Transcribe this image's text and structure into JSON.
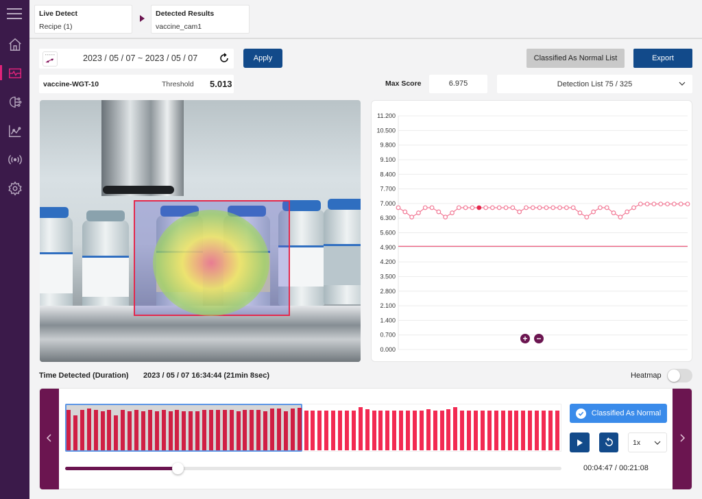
{
  "sidebar": {
    "items": [
      {
        "name": "home",
        "active": false
      },
      {
        "name": "monitor",
        "active": true
      },
      {
        "name": "ai-model",
        "active": false
      },
      {
        "name": "analytics",
        "active": false
      },
      {
        "name": "broadcast",
        "active": false
      },
      {
        "name": "settings",
        "active": false
      }
    ]
  },
  "breadcrumb": [
    {
      "title": "Live Detect",
      "subtitle": "Recipe (1)"
    },
    {
      "title": "Detected Results",
      "subtitle": "vaccine_cam1"
    }
  ],
  "filters": {
    "date_range": "2023 / 05 / 07 ~ 2023 / 05 / 07",
    "apply_label": "Apply",
    "classified_list_label": "Classified As Normal List",
    "export_label": "Export"
  },
  "info": {
    "model_name": "vaccine-WGT-10",
    "threshold_label": "Threshold",
    "threshold_value": "5.013",
    "max_score_label": "Max Score",
    "max_score_value": "6.975",
    "detection_list": "Detection List 75 / 325"
  },
  "chart_data": {
    "type": "line",
    "title": "",
    "xlabel": "",
    "ylabel": "",
    "ylim": [
      0,
      11.2
    ],
    "y_ticks": [
      "11.200",
      "10.500",
      "9.800",
      "9.100",
      "8.400",
      "7.700",
      "7.000",
      "6.300",
      "5.600",
      "4.900",
      "4.200",
      "3.500",
      "2.800",
      "2.100",
      "1.400",
      "0.700",
      "0.000"
    ],
    "grid": true,
    "threshold": 4.95,
    "highlight_index": 12,
    "values": [
      6.8,
      6.6,
      6.35,
      6.55,
      6.8,
      6.8,
      6.6,
      6.35,
      6.55,
      6.8,
      6.8,
      6.8,
      6.8,
      6.8,
      6.8,
      6.8,
      6.8,
      6.8,
      6.6,
      6.8,
      6.8,
      6.8,
      6.8,
      6.8,
      6.8,
      6.8,
      6.8,
      6.55,
      6.35,
      6.6,
      6.8,
      6.8,
      6.55,
      6.35,
      6.6,
      6.8,
      6.975,
      6.975,
      6.975,
      6.975,
      6.975,
      6.975,
      6.975,
      6.975
    ],
    "zoom_in_label": "+",
    "zoom_out_label": "−"
  },
  "time_detected": {
    "label": "Time Detected (Duration)",
    "value": "2023 / 05 / 07 16:34:44 (21min 8sec)"
  },
  "heatmap": {
    "label": "Heatmap",
    "enabled": false
  },
  "timeline": {
    "bars": [
      0.92,
      0.8,
      0.92,
      0.95,
      0.92,
      0.89,
      0.92,
      0.8,
      0.92,
      0.89,
      0.92,
      0.89,
      0.92,
      0.89,
      0.92,
      0.89,
      0.92,
      0.89,
      0.89,
      0.89,
      0.92,
      0.92,
      0.92,
      0.92,
      0.92,
      0.89,
      0.92,
      0.92,
      0.92,
      0.89,
      0.95,
      0.95,
      0.89,
      0.95,
      0.97,
      0.9,
      0.9,
      0.9,
      0.9,
      0.9,
      0.9,
      0.9,
      0.9,
      0.98,
      0.93,
      0.9,
      0.9,
      0.9,
      0.9,
      0.9,
      0.9,
      0.9,
      0.9,
      0.93,
      0.9,
      0.9,
      0.93,
      0.98,
      0.9,
      0.9,
      0.9,
      0.9,
      0.9,
      0.9,
      0.9,
      0.9,
      0.9,
      0.9,
      0.9,
      0.9,
      0.9,
      0.9,
      0.9
    ],
    "selected_count": 35,
    "selected_color": "#d01f44",
    "bar_color": "#f22a52",
    "classified_label": "Classified As Normal",
    "speed": "1x",
    "progress": 0.226,
    "time_readout": "00:04:47 / 00:21:08"
  }
}
